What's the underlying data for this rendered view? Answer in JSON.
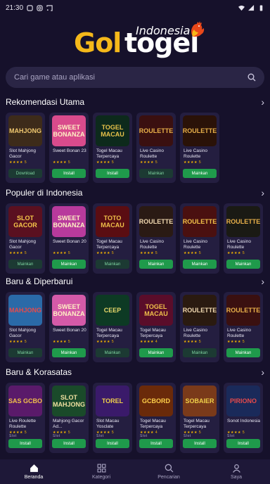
{
  "status": {
    "time": "21:30"
  },
  "logo": {
    "gol": "Gol",
    "togel": "togel",
    "sub": "Indonesia"
  },
  "search": {
    "placeholder": "Cari game atau aplikasi"
  },
  "sections": [
    {
      "title": "Rekomendasi Utama",
      "cards": [
        {
          "name": "Slot Mahjong Gacor",
          "stars": "★★★★ 5",
          "btn": "Download",
          "btn_style": "dark",
          "art": "MAHJONG",
          "bg": "#3d2b1a",
          "fg": "#f0c870"
        },
        {
          "name": "Sweet Bonan 23",
          "stars": "★★★★ 5",
          "btn": "Install",
          "btn_style": "green",
          "art": "SWEET BONANZA",
          "bg": "#d94b8c",
          "fg": "#fff3c4"
        },
        {
          "name": "Togel Macau Terpercaya",
          "stars": "★★★★ 5",
          "btn": "Install",
          "btn_style": "green",
          "art": "TOGEL MACAU",
          "bg": "#0d2a1c",
          "fg": "#e8c24a"
        },
        {
          "name": "Live Casino Roulette",
          "stars": "★★★★ 5",
          "btn": "Mainkan",
          "btn_style": "dark",
          "art": "ROULETTE",
          "bg": "#3a1010",
          "fg": "#e8b04a"
        },
        {
          "name": "Live Casino Roulette",
          "stars": "★★★★ 5",
          "btn": "Mainkan",
          "btn_style": "green",
          "art": "ROULETTE",
          "bg": "#2a1208",
          "fg": "#e8b04a"
        }
      ]
    },
    {
      "title": "Populer di Indonesia",
      "cards": [
        {
          "name": "Slot Mahjong Gacor",
          "stars": "★★★★ 5",
          "btn": "Mainkan",
          "btn_style": "dark",
          "art": "SLOT GACOR",
          "bg": "#5a1020",
          "fg": "#f7c84a"
        },
        {
          "name": "Sweet Bonan 20",
          "stars": "★★★★ 5",
          "btn": "Mainkan",
          "btn_style": "green",
          "art": "SWEET BONANZA",
          "bg": "#b83a9c",
          "fg": "#fff3c4"
        },
        {
          "name": "Togel Macau Terpercaya",
          "stars": "★★★★ 5",
          "btn": "Mainkan",
          "btn_style": "dark",
          "art": "TOTO MACAU",
          "bg": "#5a0d12",
          "fg": "#f0c04a"
        },
        {
          "name": "Live Casino Roulette",
          "stars": "★★★★ 5",
          "btn": "Mainkan",
          "btn_style": "green",
          "art": "ROULETTE",
          "bg": "#2a1a14",
          "fg": "#f0d8b0"
        },
        {
          "name": "Live Casino Roulette",
          "stars": "★★★★ 5",
          "btn": "Mainkan",
          "btn_style": "green",
          "art": "ROULETTE",
          "bg": "#4a1010",
          "fg": "#f0c04a"
        },
        {
          "name": "Live Casino Roulette",
          "stars": "★★★★ 5",
          "btn": "Mainkan",
          "btn_style": "green",
          "art": "ROULETTE",
          "bg": "#1a1a14",
          "fg": "#e8b04a"
        }
      ]
    },
    {
      "title": "Baru & Diperbarui",
      "cards": [
        {
          "name": "Slot Mahjong Gacor",
          "stars": "★★★★ 5",
          "btn": "Mainkan",
          "btn_style": "dark",
          "art": "MAHJONG",
          "bg": "#2a6aa8",
          "fg": "#e84a4a"
        },
        {
          "name": "Sweet Bonan 20",
          "stars": "★★★★ 5",
          "btn": "Mainkan",
          "btn_style": "green",
          "art": "SWEET BONANZA",
          "bg": "#d45aa8",
          "fg": "#fff3c4"
        },
        {
          "name": "Togel Macau Terpercaya",
          "stars": "★★★★ 5",
          "btn": "Mainkan",
          "btn_style": "dark",
          "art": "CEEP",
          "bg": "#0d3a24",
          "fg": "#e8d86a"
        },
        {
          "name": "Togel Macau Terpercaya",
          "stars": "★★★★ 4",
          "btn": "Mainkan",
          "btn_style": "green",
          "art": "TOGEL MACAU",
          "bg": "#5a0d2a",
          "fg": "#f0c04a"
        },
        {
          "name": "Live Casino Roulette",
          "stars": "★★★★ 5",
          "btn": "Mainkan",
          "btn_style": "dark",
          "art": "ROULETTE",
          "bg": "#2a1a10",
          "fg": "#f0d8b0"
        },
        {
          "name": "Live Casino Roulette",
          "stars": "★★★★ 5",
          "btn": "Mainkan",
          "btn_style": "green",
          "art": "ROULETTE",
          "bg": "#3a1010",
          "fg": "#e8b04a"
        }
      ]
    },
    {
      "title": "Baru & Korasatas",
      "cards": [
        {
          "name": "Live Roulette Roulette",
          "stars": "★★★★ 5",
          "sub": "Slot",
          "btn": "Install",
          "btn_style": "green",
          "art": "SAS GCBO",
          "bg": "#5a1a6a",
          "fg": "#f0c04a"
        },
        {
          "name": "Mahjong Gacor Ad...",
          "stars": "★★★★ 5",
          "sub": "Slot",
          "btn": "Install",
          "btn_style": "green",
          "art": "SLOT MAHJONG",
          "bg": "#1a4a2a",
          "fg": "#f0e0a0"
        },
        {
          "name": "Slot Macau Yosclate",
          "stars": "★★★★ 5",
          "sub": "Slot",
          "btn": "Install",
          "btn_style": "green",
          "art": "TOREL",
          "bg": "#3a1a6a",
          "fg": "#f0d04a"
        },
        {
          "name": "Togel Macau Terpercaya",
          "stars": "★★★★ 4",
          "sub": "Slot",
          "btn": "Install",
          "btn_style": "green",
          "art": "GCBORD",
          "bg": "#6a2a0a",
          "fg": "#ffd04a"
        },
        {
          "name": "Togel Macau Terpercaya",
          "stars": "★★★★ 5",
          "sub": "Slot",
          "btn": "Install",
          "btn_style": "green",
          "art": "SOBAIER",
          "bg": "#7a3a1a",
          "fg": "#f0d04a"
        },
        {
          "name": "Sonot Indonesia",
          "stars": "★★★★ 5",
          "sub": "Slot",
          "btn": "Install",
          "btn_style": "green",
          "art": "PIRIONO",
          "bg": "#1a2a5a",
          "fg": "#e84a4a"
        }
      ]
    }
  ],
  "nav": [
    {
      "label": "Beranda",
      "icon": "home-icon",
      "active": true
    },
    {
      "label": "Kategori",
      "icon": "grid-icon",
      "active": false
    },
    {
      "label": "Pencarian",
      "icon": "search-icon",
      "active": false
    },
    {
      "label": "Saya",
      "icon": "profile-icon",
      "active": false
    }
  ],
  "colors": {
    "background": "#16112b",
    "card": "#241e40",
    "accent_green": "#1f9a4b",
    "gold": "#f5b81a"
  }
}
